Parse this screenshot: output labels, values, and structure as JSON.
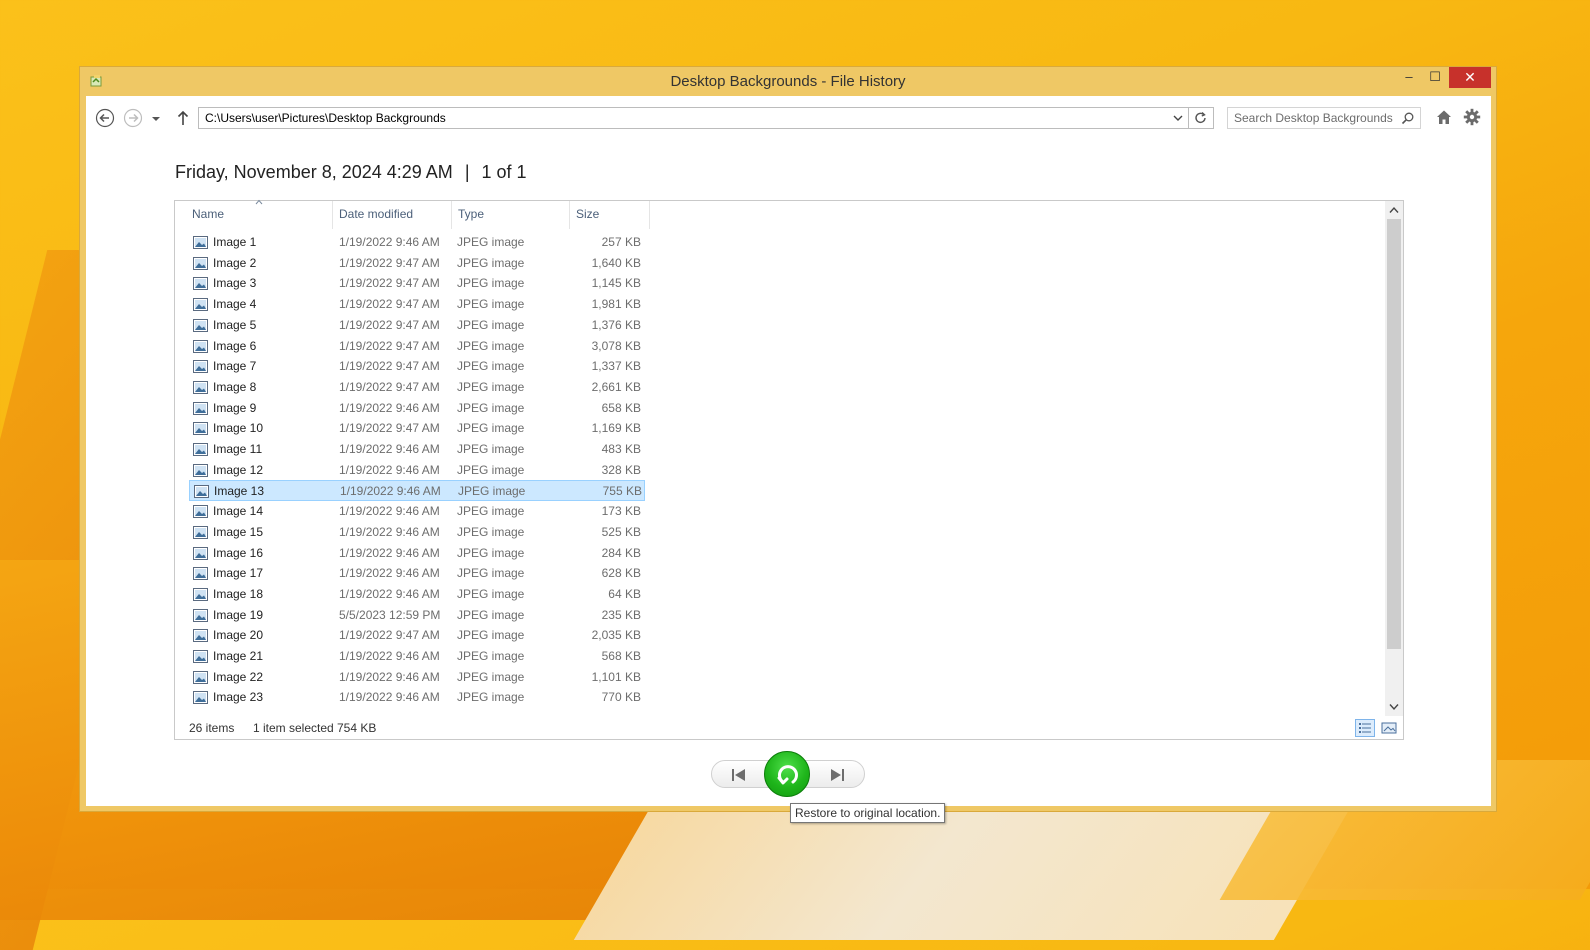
{
  "window": {
    "title": "Desktop Backgrounds - File History",
    "controls": {
      "minimize": "–",
      "maximize": "☐",
      "close": "✕"
    }
  },
  "navbar": {
    "address": "C:\\Users\\user\\Pictures\\Desktop Backgrounds",
    "search_placeholder": "Search Desktop Backgrounds"
  },
  "header": {
    "date": "Friday, November 8, 2024 4:29 AM",
    "separator": "|",
    "position": "1 of 1"
  },
  "columns": [
    "Name",
    "Date modified",
    "Type",
    "Size"
  ],
  "rows": [
    {
      "name": "Image 1",
      "date": "1/19/2022 9:46 AM",
      "type": "JPEG image",
      "size": "257 KB"
    },
    {
      "name": "Image 2",
      "date": "1/19/2022 9:47 AM",
      "type": "JPEG image",
      "size": "1,640 KB"
    },
    {
      "name": "Image 3",
      "date": "1/19/2022 9:47 AM",
      "type": "JPEG image",
      "size": "1,145 KB"
    },
    {
      "name": "Image 4",
      "date": "1/19/2022 9:47 AM",
      "type": "JPEG image",
      "size": "1,981 KB"
    },
    {
      "name": "Image 5",
      "date": "1/19/2022 9:47 AM",
      "type": "JPEG image",
      "size": "1,376 KB"
    },
    {
      "name": "Image 6",
      "date": "1/19/2022 9:47 AM",
      "type": "JPEG image",
      "size": "3,078 KB"
    },
    {
      "name": "Image 7",
      "date": "1/19/2022 9:47 AM",
      "type": "JPEG image",
      "size": "1,337 KB"
    },
    {
      "name": "Image 8",
      "date": "1/19/2022 9:47 AM",
      "type": "JPEG image",
      "size": "2,661 KB"
    },
    {
      "name": "Image 9",
      "date": "1/19/2022 9:46 AM",
      "type": "JPEG image",
      "size": "658 KB"
    },
    {
      "name": "Image 10",
      "date": "1/19/2022 9:47 AM",
      "type": "JPEG image",
      "size": "1,169 KB"
    },
    {
      "name": "Image 11",
      "date": "1/19/2022 9:46 AM",
      "type": "JPEG image",
      "size": "483 KB"
    },
    {
      "name": "Image 12",
      "date": "1/19/2022 9:46 AM",
      "type": "JPEG image",
      "size": "328 KB"
    },
    {
      "name": "Image 13",
      "date": "1/19/2022 9:46 AM",
      "type": "JPEG image",
      "size": "755 KB",
      "selected": true
    },
    {
      "name": "Image 14",
      "date": "1/19/2022 9:46 AM",
      "type": "JPEG image",
      "size": "173 KB"
    },
    {
      "name": "Image 15",
      "date": "1/19/2022 9:46 AM",
      "type": "JPEG image",
      "size": "525 KB"
    },
    {
      "name": "Image 16",
      "date": "1/19/2022 9:46 AM",
      "type": "JPEG image",
      "size": "284 KB"
    },
    {
      "name": "Image 17",
      "date": "1/19/2022 9:46 AM",
      "type": "JPEG image",
      "size": "628 KB"
    },
    {
      "name": "Image 18",
      "date": "1/19/2022 9:46 AM",
      "type": "JPEG image",
      "size": "64 KB"
    },
    {
      "name": "Image 19",
      "date": "5/5/2023 12:59 PM",
      "type": "JPEG image",
      "size": "235 KB"
    },
    {
      "name": "Image 20",
      "date": "1/19/2022 9:47 AM",
      "type": "JPEG image",
      "size": "2,035 KB"
    },
    {
      "name": "Image 21",
      "date": "1/19/2022 9:46 AM",
      "type": "JPEG image",
      "size": "568 KB"
    },
    {
      "name": "Image 22",
      "date": "1/19/2022 9:46 AM",
      "type": "JPEG image",
      "size": "1,101 KB"
    },
    {
      "name": "Image 23",
      "date": "1/19/2022 9:46 AM",
      "type": "JPEG image",
      "size": "770 KB"
    }
  ],
  "status": {
    "items": "26 items",
    "selected": "1 item selected",
    "selected_size": "754 KB"
  },
  "tooltip": "Restore to original location.",
  "colors": {
    "accent_selection": "#cce8ff",
    "close_button": "#c7312b",
    "restore_green": "#1fb51b",
    "window_frame": "#efc865"
  },
  "icons": {
    "back": "back-arrow-icon",
    "forward": "forward-arrow-icon",
    "up": "up-arrow-icon",
    "refresh": "refresh-icon",
    "search": "search-icon",
    "home": "home-icon",
    "settings": "gear-icon",
    "file": "jpeg-file-icon",
    "restore": "restore-icon",
    "previous": "previous-version-icon",
    "next": "next-version-icon"
  }
}
